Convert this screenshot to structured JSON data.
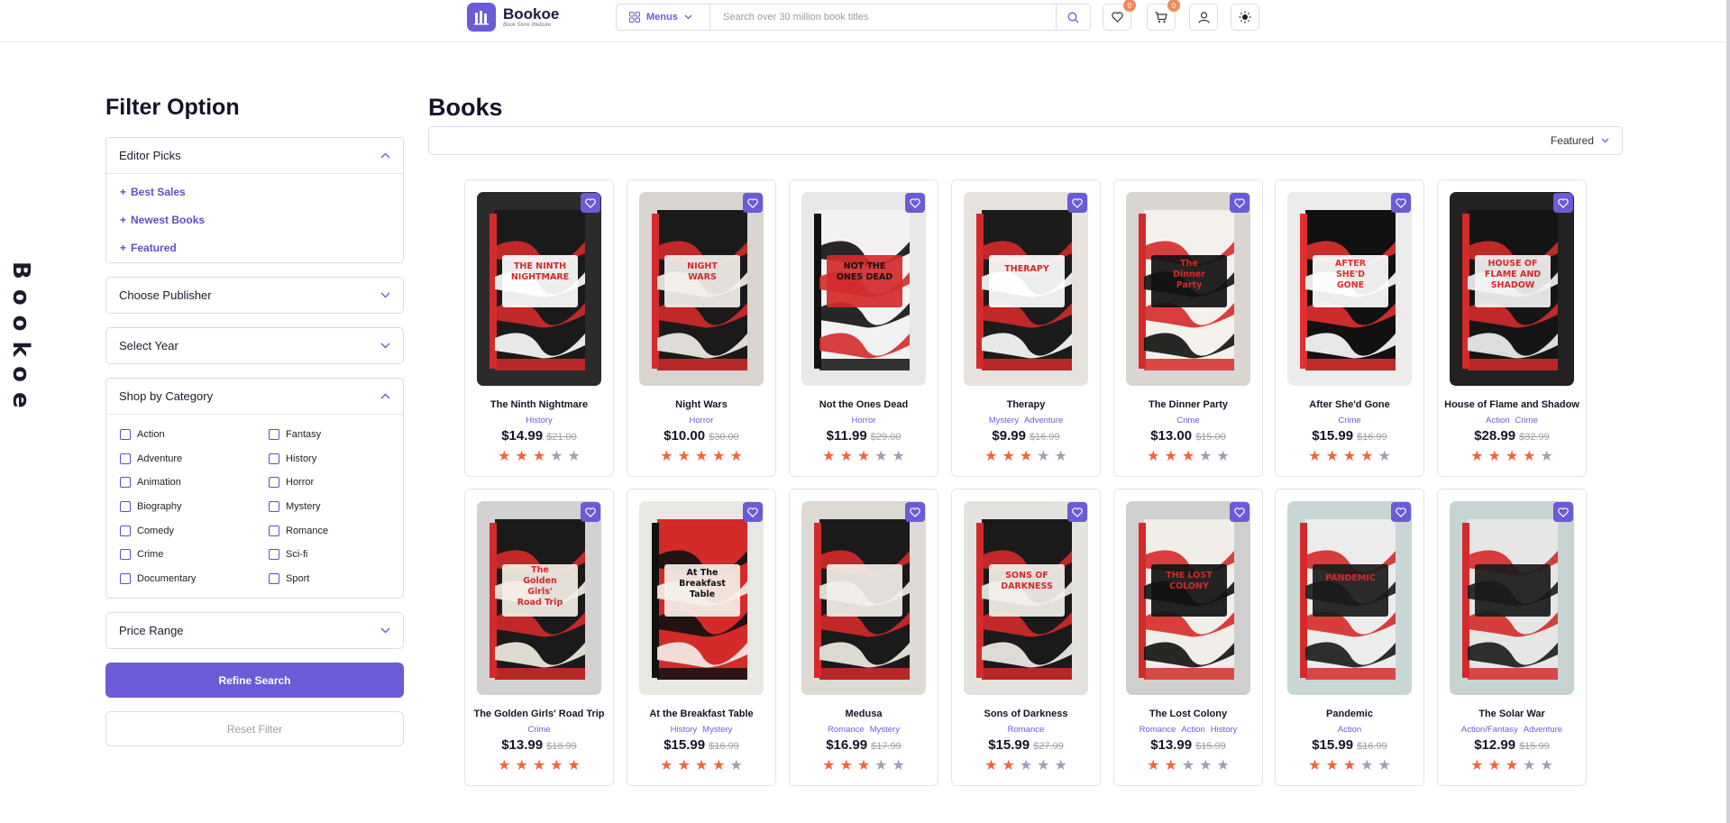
{
  "brand": {
    "name": "Bookoe",
    "tagline": "Book Store Website",
    "side_text": "Bookoe"
  },
  "search": {
    "menus_label": "Menus",
    "placeholder": "Search over 30 million book titles"
  },
  "header_icons": {
    "wishlist_count": "0",
    "cart_count": "0"
  },
  "filters": {
    "title": "Filter Option",
    "editor_picks": {
      "label": "Editor Picks",
      "items": [
        "Best Sales",
        "Newest Books",
        "Featured"
      ]
    },
    "publisher_label": "Choose Publisher",
    "year_label": "Select Year",
    "category": {
      "label": "Shop by Category",
      "items": [
        "Action",
        "Fantasy",
        "Adventure",
        "History",
        "Animation",
        "Horror",
        "Biography",
        "Mystery",
        "Comedy",
        "Romance",
        "Crime",
        "Sci-fi",
        "Documentary",
        "Sport"
      ]
    },
    "price_label": "Price Range",
    "refine_label": "Refine Search",
    "reset_label": "Reset Filter"
  },
  "main": {
    "title": "Books",
    "sort_value": "Featured"
  },
  "colors": {
    "accent": "#6b5bd6",
    "star_on": "#f2643c",
    "star_off": "#9ea0b4"
  },
  "books": [
    {
      "title": "The Ninth Nightmare",
      "genres": [
        "History"
      ],
      "price": "$14.99",
      "old_price": "$21.00",
      "rating": 3
    },
    {
      "title": "Night Wars",
      "genres": [
        "Horror"
      ],
      "price": "$10.00",
      "old_price": "$30.00",
      "rating": 5
    },
    {
      "title": "Not the Ones Dead",
      "genres": [
        "Horror"
      ],
      "price": "$11.99",
      "old_price": "$29.00",
      "rating": 3
    },
    {
      "title": "Therapy",
      "genres": [
        "Mystery",
        "Adventure"
      ],
      "price": "$9.99",
      "old_price": "$16.99",
      "rating": 3
    },
    {
      "title": "The Dinner Party",
      "genres": [
        "Crime"
      ],
      "price": "$13.00",
      "old_price": "$15.00",
      "rating": 3
    },
    {
      "title": "After She'd Gone",
      "genres": [
        "Crime"
      ],
      "price": "$15.99",
      "old_price": "$16.99",
      "rating": 4
    },
    {
      "title": "House of Flame and Shadow",
      "genres": [
        "Action",
        "Crime"
      ],
      "price": "$28.99",
      "old_price": "$32.99",
      "rating": 4
    },
    {
      "title": "The Golden Girls' Road Trip",
      "genres": [
        "Crime"
      ],
      "price": "$13.99",
      "old_price": "$18.99",
      "rating": 5
    },
    {
      "title": "At the Breakfast Table",
      "genres": [
        "History",
        "Mystery"
      ],
      "price": "$15.99",
      "old_price": "$16.99",
      "rating": 4
    },
    {
      "title": "Medusa",
      "genres": [
        "Romance",
        "Mystery"
      ],
      "price": "$16.99",
      "old_price": "$17.99",
      "rating": 3
    },
    {
      "title": "Sons of Darkness",
      "genres": [
        "Romance"
      ],
      "price": "$15.99",
      "old_price": "$27.99",
      "rating": 2
    },
    {
      "title": "The Lost Colony",
      "genres": [
        "Romance",
        "Action",
        "History"
      ],
      "price": "$13.99",
      "old_price": "$15.99",
      "rating": 2
    },
    {
      "title": "Pandemic",
      "genres": [
        "Action"
      ],
      "price": "$15.99",
      "old_price": "$16.99",
      "rating": 3
    },
    {
      "title": "The Solar War",
      "genres": [
        "Action/Fantasy",
        "Adventure"
      ],
      "price": "$12.99",
      "old_price": "$15.99",
      "rating": 3
    }
  ],
  "cover_titles": [
    "THE NINTH NIGHTMARE",
    "NIGHT WARS",
    "NOT THE ONES DEAD",
    "THERAPY",
    "The Dinner Party",
    "AFTER SHE'D GONE",
    "HOUSE OF FLAME AND SHADOW",
    "The Golden Girls' Road Trip",
    "At The Breakfast Table",
    "",
    "SONS OF DARKNESS",
    "THE LOST COLONY",
    "PANDEMIC",
    ""
  ]
}
